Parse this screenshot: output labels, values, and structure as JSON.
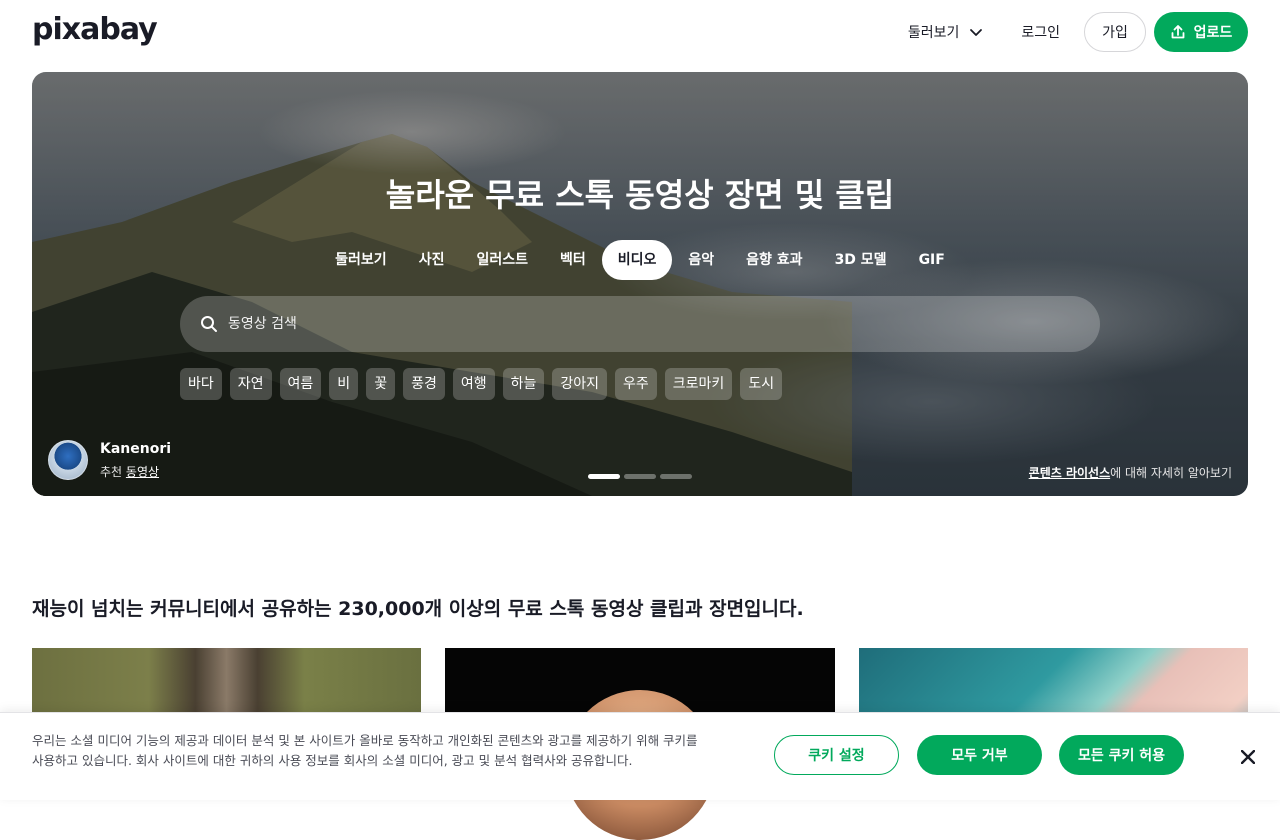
{
  "header": {
    "logo": "pixabay",
    "explore_label": "둘러보기",
    "login_label": "로그인",
    "join_label": "가입",
    "upload_label": "업로드"
  },
  "hero": {
    "title": "놀라운 무료 스톡 동영상 장면 및 클립",
    "tabs": [
      {
        "label": "둘러보기",
        "active": false
      },
      {
        "label": "사진",
        "active": false
      },
      {
        "label": "일러스트",
        "active": false
      },
      {
        "label": "벡터",
        "active": false
      },
      {
        "label": "비디오",
        "active": true
      },
      {
        "label": "음악",
        "active": false
      },
      {
        "label": "음향 효과",
        "active": false
      },
      {
        "label": "3D 모델",
        "active": false
      },
      {
        "label": "GIF",
        "active": false
      }
    ],
    "search_placeholder": "동영상 검색",
    "chips": [
      "바다",
      "자연",
      "여름",
      "비",
      "꽃",
      "풍경",
      "여행",
      "하늘",
      "강아지",
      "우주",
      "크로마키",
      "도시"
    ],
    "credit": {
      "name": "Kanenori",
      "sub_prefix": "추천 ",
      "sub_link": "동영상"
    },
    "license": {
      "link": "콘텐츠 라이선스",
      "suffix": "에 대해 자세히 알아보기"
    },
    "slides": 3,
    "active_slide": 1
  },
  "section": {
    "title": "재능이 넘치는 커뮤니티에서 공유하는 230,000개 이상의 무료 스톡 동영상 클립과 장면입니다."
  },
  "cookie": {
    "text": "우리는 소셜 미디어 기능의 제공과 데이터 분석 및 본 사이트가 올바로 동작하고 개인화된 콘텐츠와 광고를 제공하기 위해 쿠키를 사용하고 있습니다. 회사 사이트에 대한 귀하의 사용 정보를 회사의 소셜 미디어, 광고 및 분석 협력사와 공유합니다.",
    "settings_label": "쿠키 설정",
    "reject_label": "모두 거부",
    "accept_label": "모든 쿠키 허용"
  },
  "colors": {
    "brand_green": "#02a95c",
    "text_dark": "#191b26"
  }
}
